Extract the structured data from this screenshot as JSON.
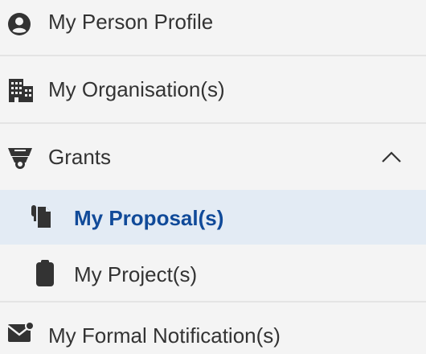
{
  "menu": {
    "items": [
      {
        "label": "My Person Profile",
        "icon": "person-circle-icon"
      },
      {
        "label": "My Organisation(s)",
        "icon": "building-icon"
      },
      {
        "label": "Grants",
        "icon": "grants-icon",
        "expanded": true
      },
      {
        "label": "My Proposal(s)",
        "icon": "documents-icon",
        "active": true
      },
      {
        "label": "My Project(s)",
        "icon": "clipboard-icon"
      },
      {
        "label": "My Formal Notification(s)",
        "icon": "mail-notification-icon"
      }
    ]
  },
  "colors": {
    "active_background": "#e3ebf4",
    "active_text": "#104a99",
    "text": "#333333",
    "background": "#f4f4f4",
    "divider": "#e4e4e4"
  }
}
